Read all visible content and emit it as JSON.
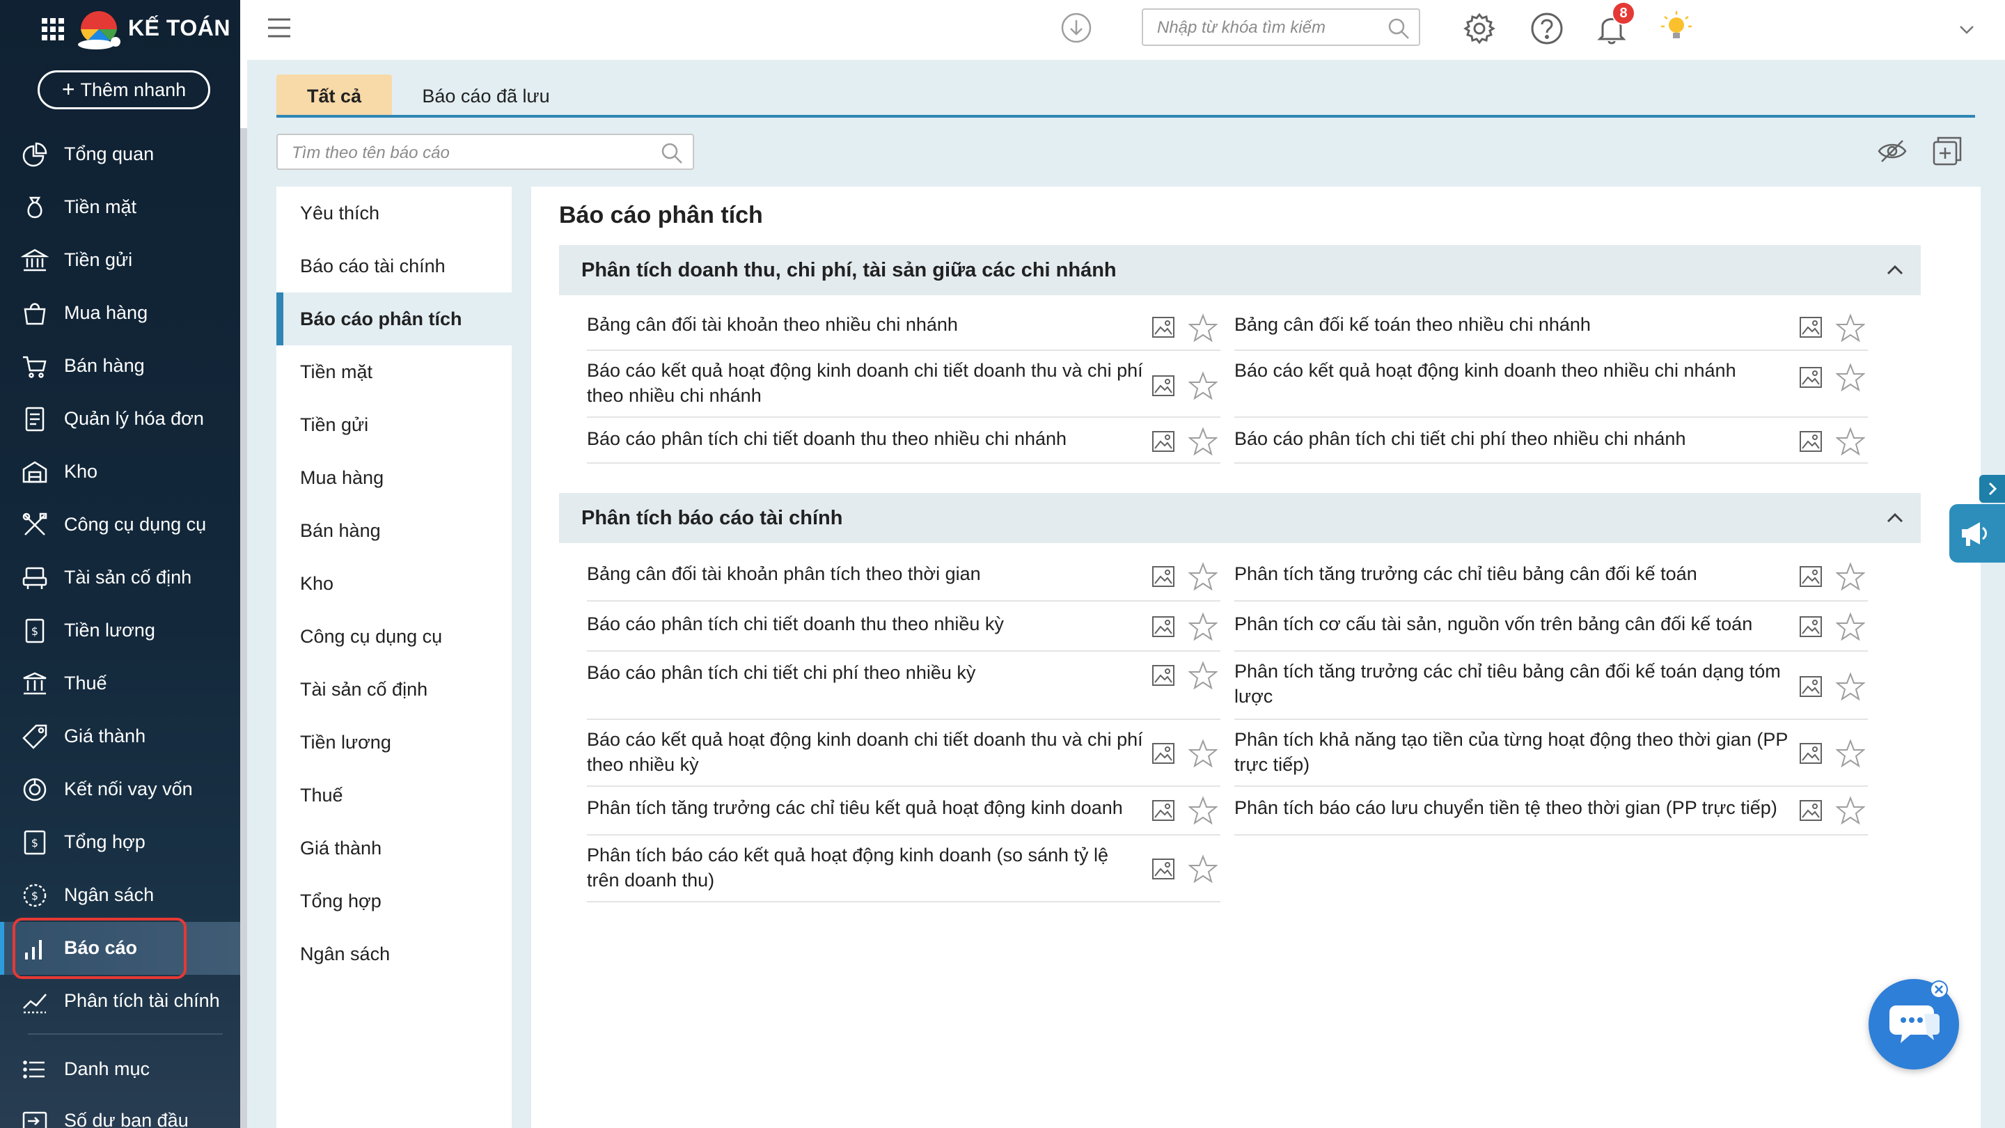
{
  "brand": {
    "name": "KẾ TOÁN"
  },
  "quick_add": {
    "label": "Thêm nhanh"
  },
  "sidebar": {
    "items": [
      {
        "label": "Tổng quan",
        "icon": "chart-pie-icon"
      },
      {
        "label": "Tiền mặt",
        "icon": "money-bag-icon"
      },
      {
        "label": "Tiền gửi",
        "icon": "bank-icon"
      },
      {
        "label": "Mua hàng",
        "icon": "shopping-bag-icon"
      },
      {
        "label": "Bán hàng",
        "icon": "cart-icon"
      },
      {
        "label": "Quản lý hóa đơn",
        "icon": "invoice-icon"
      },
      {
        "label": "Kho",
        "icon": "warehouse-icon"
      },
      {
        "label": "Công cụ dụng cụ",
        "icon": "tools-icon"
      },
      {
        "label": "Tài sản cố định",
        "icon": "asset-icon"
      },
      {
        "label": "Tiền lương",
        "icon": "salary-icon"
      },
      {
        "label": "Thuế",
        "icon": "tax-icon"
      },
      {
        "label": "Giá thành",
        "icon": "price-tag-icon"
      },
      {
        "label": "Kết nối vay vốn",
        "icon": "loan-icon"
      },
      {
        "label": "Tổng hợp",
        "icon": "summary-icon"
      },
      {
        "label": "Ngân sách",
        "icon": "budget-icon"
      },
      {
        "label": "Báo cáo",
        "icon": "bar-chart-icon",
        "active": true
      },
      {
        "label": "Phân tích tài chính",
        "icon": "analysis-chart-icon"
      },
      {
        "label": "Danh mục",
        "icon": "list-icon"
      },
      {
        "label": "Số dư ban đầu",
        "icon": "opening-balance-icon"
      }
    ]
  },
  "topbar": {
    "search_placeholder": "Nhập từ khóa tìm kiếm",
    "notification_count": "8"
  },
  "tabs": [
    {
      "label": "Tất cả",
      "active": true
    },
    {
      "label": "Báo cáo đã lưu",
      "active": false
    }
  ],
  "report_search": {
    "placeholder": "Tìm theo tên báo cáo"
  },
  "categories": [
    {
      "label": "Yêu thích"
    },
    {
      "label": "Báo cáo tài chính"
    },
    {
      "label": "Báo cáo phân tích",
      "active": true
    },
    {
      "label": "Tiền mặt"
    },
    {
      "label": "Tiền gửi"
    },
    {
      "label": "Mua hàng"
    },
    {
      "label": "Bán hàng"
    },
    {
      "label": "Kho"
    },
    {
      "label": "Công cụ dụng cụ"
    },
    {
      "label": "Tài sản cố định"
    },
    {
      "label": "Tiền lương"
    },
    {
      "label": "Thuế"
    },
    {
      "label": "Giá thành"
    },
    {
      "label": "Tổng hợp"
    },
    {
      "label": "Ngân sách"
    }
  ],
  "content": {
    "title": "Báo cáo phân tích",
    "sections": [
      {
        "title": "Phân tích doanh thu, chi phí, tài sản giữa các chi nhánh",
        "reports": [
          "Bảng cân đối tài khoản theo nhiều chi nhánh",
          "Bảng cân đối kế toán theo nhiều chi nhánh",
          "Báo cáo kết quả hoạt động kinh doanh chi tiết doanh thu và chi phí theo nhiều chi nhánh",
          "Báo cáo kết quả hoạt động kinh doanh theo nhiều chi nhánh",
          "Báo cáo phân tích chi tiết doanh thu theo nhiều chi nhánh",
          "Báo cáo phân tích chi tiết chi phí theo nhiều chi nhánh"
        ]
      },
      {
        "title": "Phân tích báo cáo tài chính",
        "reports": [
          "Bảng cân đối tài khoản phân tích theo thời gian",
          "Phân tích tăng trưởng các chỉ tiêu bảng cân đối kế toán",
          "Báo cáo phân tích chi tiết doanh thu theo nhiều kỳ",
          "Phân tích cơ cấu tài sản, nguồn vốn trên bảng cân đối kế toán",
          "Báo cáo phân tích chi tiết chi phí theo nhiều kỳ",
          "Phân tích tăng trưởng các chỉ tiêu bảng cân đối kế toán dạng tóm lược",
          "Báo cáo kết quả hoạt động kinh doanh chi tiết doanh thu và chi phí theo nhiều kỳ",
          "Phân tích khả năng tạo tiền của từng hoạt động theo thời gian (PP trực tiếp)",
          "Phân tích tăng trưởng các chỉ tiêu kết quả hoạt động kinh doanh",
          "Phân tích báo cáo lưu chuyển tiền tệ theo thời gian (PP trực tiếp)",
          "Phân tích báo cáo kết quả hoạt động kinh doanh (so sánh tỷ lệ trên doanh thu)"
        ]
      }
    ]
  },
  "colors": {
    "sidebar_bg": "#13283b",
    "accent_blue": "#2f86b4",
    "active_tab": "#f8d9a8",
    "badge_red": "#e53935",
    "main_bg": "#e3eef3"
  }
}
